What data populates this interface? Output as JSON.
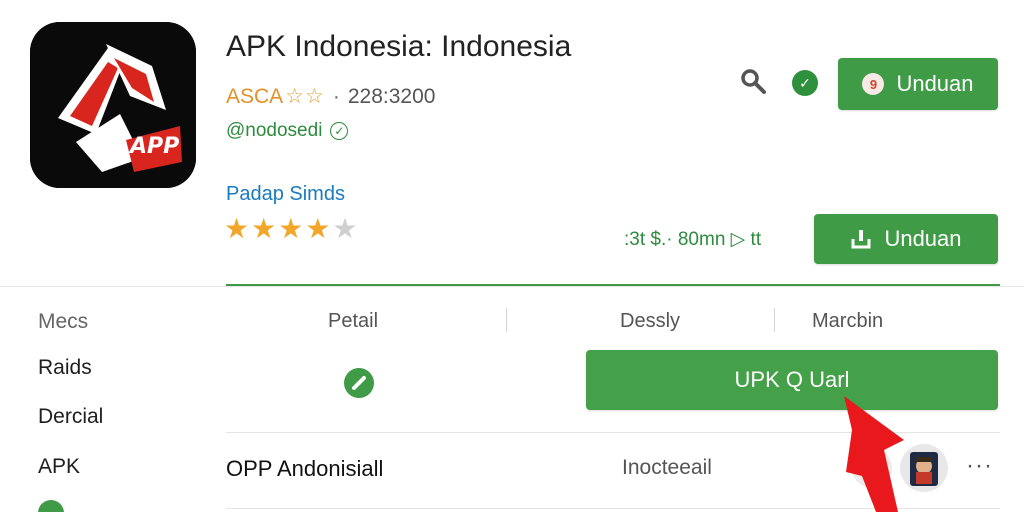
{
  "app": {
    "title": "APK Indonesia: Indonesia",
    "icon_text": "APP",
    "developer": "ASCA",
    "star_outline": "☆☆",
    "separator": "·",
    "downloads": "228:3200",
    "handle": "@nodosedi",
    "category": "Padap Simds",
    "rating_filled": "★★★★",
    "rating_empty": "★",
    "rating_value": 4
  },
  "header": {
    "search_icon": "search-icon",
    "verified_icon": "verified-icon",
    "download_label_top": "Unduan",
    "download_label_mid": "Unduan",
    "size_info": ":3t $.· 80mn ▷ tt"
  },
  "sidebar": {
    "items": [
      {
        "label": "Mecs"
      },
      {
        "label": "Raids"
      },
      {
        "label": "Dercial"
      },
      {
        "label": "APK"
      }
    ]
  },
  "columns": {
    "headers": [
      "Petail",
      "Dessly",
      "Marcbin"
    ]
  },
  "main": {
    "primary_button_label": "UPK Q Uarl",
    "row": {
      "name": "OPP Andonisiall",
      "code": "Inocteeail",
      "more": "···"
    }
  },
  "colors": {
    "accent_green": "#3f9b45",
    "star_orange": "#f2a72b",
    "link_blue": "#1a7bbf",
    "arrow_red": "#e8181c"
  }
}
